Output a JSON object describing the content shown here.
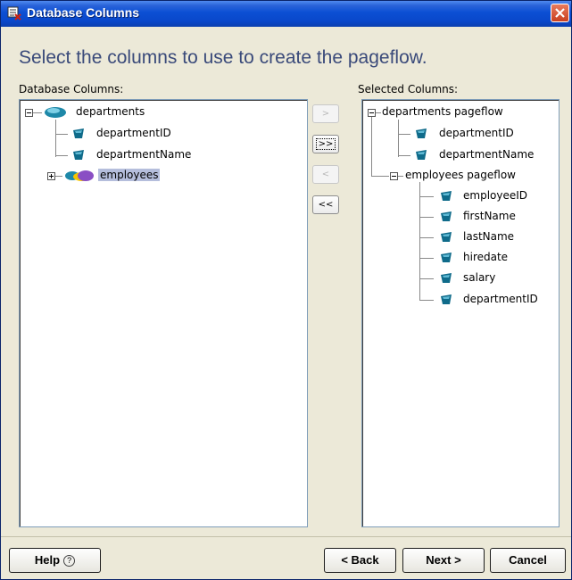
{
  "window": {
    "title": "Database Columns"
  },
  "heading": "Select the columns to use to create the pageflow.",
  "left_panel": {
    "label": "Database Columns:",
    "tree": {
      "departments": {
        "label": "departments",
        "children": [
          "departmentID",
          "departmentName"
        ]
      },
      "employees": {
        "label": "employees",
        "expanded": false,
        "selected": true
      }
    }
  },
  "transfer_buttons": {
    "add": ">",
    "add_all": ">>",
    "remove": "<",
    "remove_all": "<<"
  },
  "right_panel": {
    "label": "Selected Columns:",
    "tree": {
      "departments_pageflow": {
        "label": "departments pageflow",
        "children": [
          "departmentID",
          "departmentName"
        ]
      },
      "employees_pageflow": {
        "label": "employees pageflow",
        "children": [
          "employeeID",
          "firstName",
          "lastName",
          "hiredate",
          "salary",
          "departmentID"
        ]
      }
    }
  },
  "buttons": {
    "help": "Help",
    "help_glyph": "?",
    "back": "< Back",
    "next": "Next >",
    "cancel": "Cancel"
  },
  "colors": {
    "title_bar": "#0a47c9",
    "heading": "#3a4a7a",
    "selection": "#b5bedc",
    "column_icon": "#0f6b8a"
  }
}
